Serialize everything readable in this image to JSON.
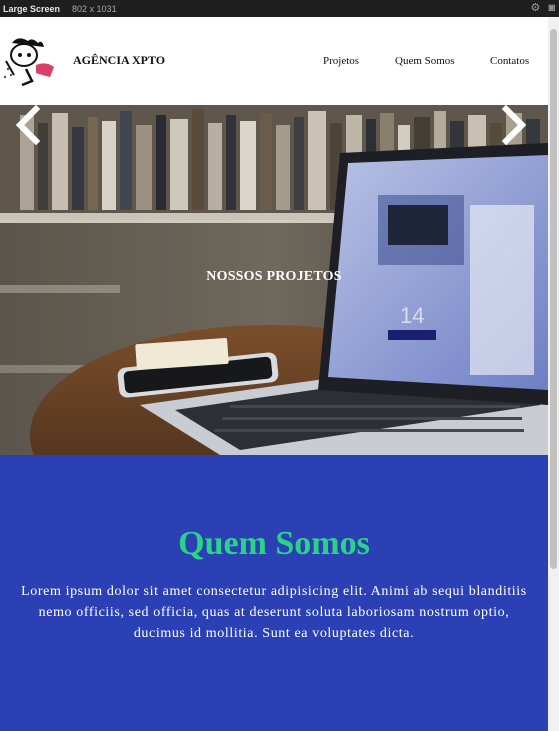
{
  "devbar": {
    "label": "Large Screen",
    "dims": "802 x 1031"
  },
  "header": {
    "brand": "AGÊNCIA XPTO",
    "nav": [
      "Projetos",
      "Quem Somos",
      "Contatos"
    ]
  },
  "hero": {
    "title": "NOSSOS PROJETOS",
    "screen_text": "14"
  },
  "about": {
    "title": "Quem Somos",
    "text": "Lorem ipsum dolor sit amet consectetur adipisicing elit. Animi ab sequi blanditiis nemo officiis, sed officia, quas at deserunt soluta laboriosam nostrum optio, ducimus id mollitia. Sunt ea voluptates dicta."
  },
  "colors": {
    "about_bg": "#2b40b4",
    "about_title": "#2ad486"
  },
  "icons": [
    "gear-icon",
    "camera-icon",
    "chevron-left-icon",
    "chevron-right-icon"
  ]
}
